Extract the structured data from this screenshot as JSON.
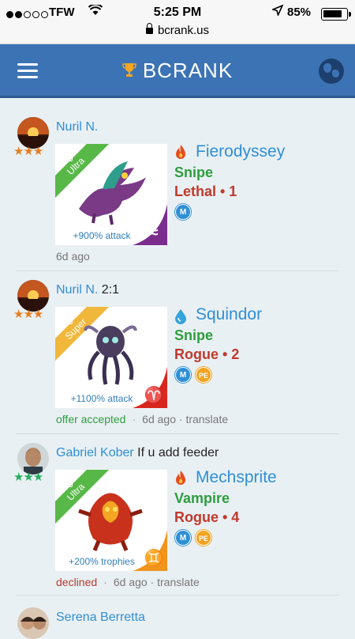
{
  "status_bar": {
    "carrier": "TFW",
    "time": "5:25 PM",
    "battery": "85%",
    "battery_level": 0.85,
    "url": "bcrank.us"
  },
  "header": {
    "brand": "BCRANK",
    "menu_icon": "hamburger-menu-icon",
    "region_icon": "globe-icon"
  },
  "colors": {
    "header_bg": "#3c73b4",
    "link_blue": "#2f8fd6",
    "role_green": "#2e9e3e",
    "rank_red": "#c0392b",
    "ultra_green": "#58b847",
    "super_gold": "#f1b73a"
  },
  "posts": [
    {
      "author": "Nuril N.",
      "message": "",
      "stars": "★★★",
      "card_tier": "Ultra",
      "card_bonus": "+900% attack",
      "element_icon": "fire-icon",
      "monster_name": "Fierodyssey",
      "role": "Snipe",
      "rank": "Lethal • 1",
      "badges": [
        "M"
      ],
      "status": "",
      "age": "6d ago",
      "translate": ""
    },
    {
      "author": "Nuril N.",
      "message": "2:1",
      "stars": "★★★",
      "card_tier": "Super",
      "card_bonus": "+1100% attack",
      "element_icon": "water-drop-icon",
      "monster_name": "Squindor",
      "role": "Snipe",
      "rank": "Rogue • 2",
      "badges": [
        "M",
        "PE"
      ],
      "status": "offer accepted",
      "age": "6d ago",
      "translate": "translate"
    },
    {
      "author": "Gabriel Kober",
      "message": "If u add feeder",
      "stars": "★★★",
      "card_tier": "Ultra",
      "card_bonus": "+200% trophies",
      "element_icon": "fire-icon",
      "monster_name": "Mechsprite",
      "role": "Vampire",
      "rank": "Rogue • 4",
      "badges": [
        "M",
        "PE"
      ],
      "status": "declined",
      "age": "6d ago",
      "translate": "translate"
    },
    {
      "author": "Serena Berretta"
    }
  ]
}
